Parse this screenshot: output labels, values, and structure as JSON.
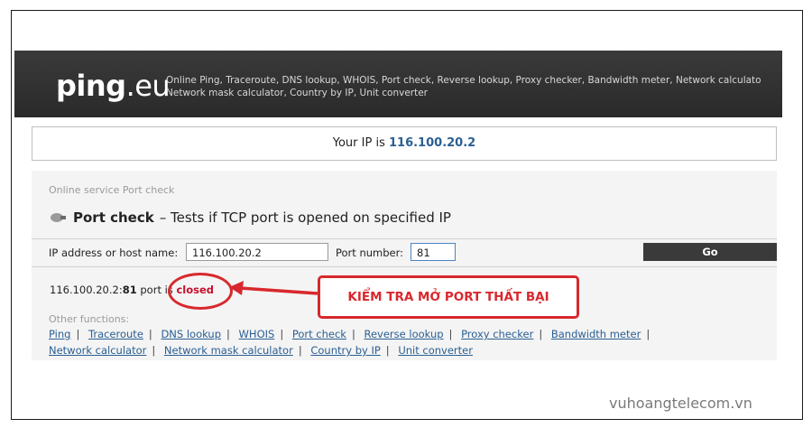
{
  "header": {
    "logo_name": "ping",
    "logo_tld": ".eu",
    "tagline_line1": "Online Ping, Traceroute, DNS lookup, WHOIS, Port check, Reverse lookup, Proxy checker, Bandwidth meter, Network calculato",
    "tagline_line2": "Network mask calculator, Country by IP, Unit converter",
    "bg_color": "#2e2e2e"
  },
  "ip_banner": {
    "label": "Your IP is ",
    "ip": "116.100.20.2"
  },
  "panel": {
    "breadcrumb": "Online service Port check",
    "title": "Port check",
    "title_desc": "– Tests if TCP port is opened on specified IP",
    "ip_label": "IP address or host name:",
    "ip_value": "116.100.20.2",
    "port_label": "Port number:",
    "port_value": "81",
    "go_label": "Go"
  },
  "result": {
    "host": "116.100.20.2:",
    "port": "81",
    "text_a": " port ",
    "text_b": "is ",
    "status": "closed",
    "status_color": "#c8102e"
  },
  "other_functions": {
    "label": "Other functions:",
    "links_row1": [
      "Ping",
      "Traceroute",
      "DNS lookup",
      "WHOIS",
      "Port check",
      "Reverse lookup",
      "Proxy checker",
      "Bandwidth meter"
    ],
    "links_row2": [
      "Network calculator",
      "Network mask calculator",
      "Country by IP",
      "Unit converter"
    ]
  },
  "annotation": {
    "text": "KIỂM TRA MỞ PORT THẤT BẠI",
    "color": "#d8282d"
  },
  "watermark": "vuhoangtelecom.vn"
}
